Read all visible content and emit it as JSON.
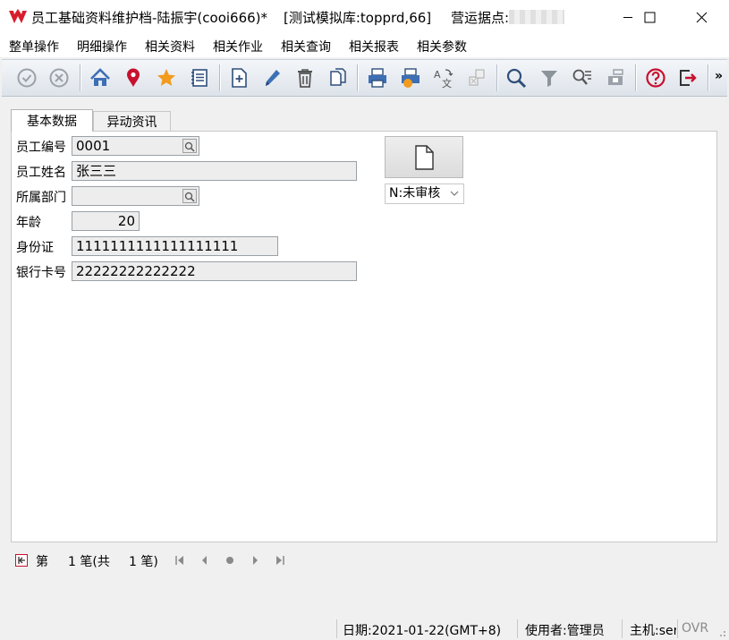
{
  "window": {
    "title": "员工基础资料维护档-陆振宇(cooi666)*",
    "db": "[测试模拟库:topprd,66]",
    "site_label": "营运据点:"
  },
  "menu": [
    "整单操作",
    "明细操作",
    "相关资料",
    "相关作业",
    "相关查询",
    "相关报表",
    "相关参数"
  ],
  "toolbar": {
    "icons": [
      "confirm-icon",
      "cancel-icon",
      "home-icon",
      "location-pin-icon",
      "favorite-star-icon",
      "notes-icon",
      "add-icon",
      "edit-icon",
      "delete-icon",
      "copy-icon",
      "print-icon",
      "print-setup-icon",
      "translate-icon",
      "disabled-icon",
      "search-icon",
      "filter-icon",
      "query-list-icon",
      "save-icon",
      "help-icon",
      "exit-icon"
    ],
    "overflow": "»"
  },
  "tabs": [
    "基本数据",
    "异动资讯"
  ],
  "form": {
    "emp_no_label": "员工编号",
    "emp_no": "0001",
    "emp_name_label": "员工姓名",
    "emp_name": "张三三",
    "dept_label": "所属部门",
    "dept": "",
    "age_label": "年龄",
    "age": "20",
    "id_label": "身份证",
    "id": "1111111111111111111",
    "bank_label": "银行卡号",
    "bank": "22222222222222"
  },
  "status": {
    "value": "N:未审核"
  },
  "navigator": {
    "prefix": "第",
    "current": "1 笔(共",
    "total": "1 笔)"
  },
  "statusbar": {
    "date": "日期:2021-01-22(GMT+8)",
    "user": "使用者:管理员",
    "host": "主机:ser",
    "mode": "OVR"
  },
  "colors": {
    "accent_red": "#c8102e",
    "star": "#f29b1d",
    "toolbar_blue": "#3d6fb4"
  }
}
